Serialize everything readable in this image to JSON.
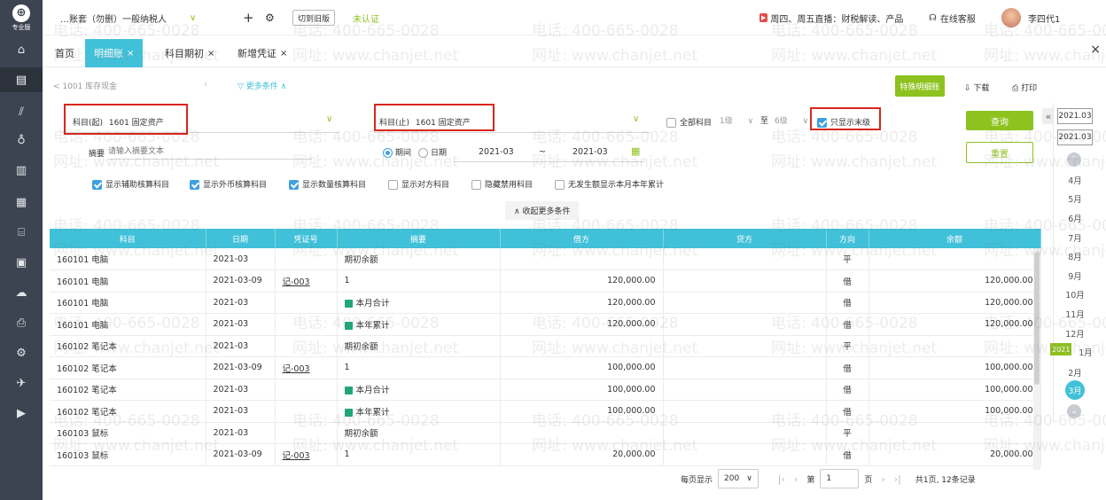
{
  "app": {
    "logo_text": "专业版",
    "account_name": "…账套（勿删）一般纳税人",
    "switch_old_label": "切到旧版",
    "verify_status": "未认证",
    "live_label": "周四、周五直播：财税解读、产品",
    "service_label": "在线客服",
    "user_name": "李四代1"
  },
  "tabs": [
    {
      "label": "首页",
      "active": false,
      "closable": false
    },
    {
      "label": "明细账",
      "active": true,
      "closable": true
    },
    {
      "label": "科目期初",
      "active": false,
      "closable": true
    },
    {
      "label": "新增凭证",
      "active": false,
      "closable": true
    }
  ],
  "toolbar": {
    "breadcrumb": "< 1001 库存现金",
    "more_conditions": "更多条件",
    "special_detail_button": "特殊明细账",
    "download_button": "下载",
    "print_button": "打印"
  },
  "filters": {
    "subject_from_label": "科目(起)",
    "subject_from_value": "1601 固定资产",
    "subject_to_label": "科目(止)",
    "subject_to_value": "1601 固定资产",
    "all_subjects_label": "全部科目",
    "level_from": "1级",
    "level_to_label": "至",
    "level_to": "6级",
    "only_leaf_label": "只显示末级",
    "summary_label": "摘要",
    "summary_placeholder": "请输入摘要文本",
    "period_label": "期间",
    "date_label": "日期",
    "period_from": "2021-03",
    "period_sep": "~",
    "period_to": "2021-03",
    "query_button": "查询",
    "reset_button": "重置",
    "options": [
      {
        "label": "显示辅助核算科目",
        "checked": true
      },
      {
        "label": "显示外币核算科目",
        "checked": true
      },
      {
        "label": "显示数量核算科目",
        "checked": true
      },
      {
        "label": "显示对方科目",
        "checked": false
      },
      {
        "label": "隐藏禁用科目",
        "checked": false
      },
      {
        "label": "无发生额显示本月本年累计",
        "checked": false
      }
    ],
    "collapse_more": "收起更多条件"
  },
  "table": {
    "headers": [
      "科目",
      "日期",
      "凭证号",
      "摘要",
      "借方",
      "贷方",
      "方向",
      "余额"
    ],
    "rows": [
      {
        "subject": "160101 电脑",
        "date": "2021-03",
        "voucher": "",
        "summary": "期初余额",
        "tag": false,
        "debit": "",
        "credit": "",
        "direction": "平",
        "balance": ""
      },
      {
        "subject": "160101 电脑",
        "date": "2021-03-09",
        "voucher": "记-003",
        "summary": "1",
        "tag": false,
        "debit": "120,000.00",
        "credit": "",
        "direction": "借",
        "balance": "120,000.00"
      },
      {
        "subject": "160101 电脑",
        "date": "2021-03",
        "voucher": "",
        "summary": "本月合计",
        "tag": true,
        "debit": "120,000.00",
        "credit": "",
        "direction": "借",
        "balance": "120,000.00"
      },
      {
        "subject": "160101 电脑",
        "date": "2021-03",
        "voucher": "",
        "summary": "本年累计",
        "tag": true,
        "debit": "120,000.00",
        "credit": "",
        "direction": "借",
        "balance": "120,000.00"
      },
      {
        "subject": "160102 笔记本",
        "date": "2021-03",
        "voucher": "",
        "summary": "期初余额",
        "tag": false,
        "debit": "",
        "credit": "",
        "direction": "平",
        "balance": ""
      },
      {
        "subject": "160102 笔记本",
        "date": "2021-03-09",
        "voucher": "记-003",
        "summary": "1",
        "tag": false,
        "debit": "100,000.00",
        "credit": "",
        "direction": "借",
        "balance": "100,000.00"
      },
      {
        "subject": "160102 笔记本",
        "date": "2021-03",
        "voucher": "",
        "summary": "本月合计",
        "tag": true,
        "debit": "100,000.00",
        "credit": "",
        "direction": "借",
        "balance": "100,000.00"
      },
      {
        "subject": "160102 笔记本",
        "date": "2021-03",
        "voucher": "",
        "summary": "本年累计",
        "tag": true,
        "debit": "100,000.00",
        "credit": "",
        "direction": "借",
        "balance": "100,000.00"
      },
      {
        "subject": "160103 鼠标",
        "date": "2021-03",
        "voucher": "",
        "summary": "期初余额",
        "tag": false,
        "debit": "",
        "credit": "",
        "direction": "平",
        "balance": ""
      },
      {
        "subject": "160103 鼠标",
        "date": "2021-03-09",
        "voucher": "记-003",
        "summary": "1",
        "tag": false,
        "debit": "20,000.00",
        "credit": "",
        "direction": "借",
        "balance": "20,000.00"
      }
    ]
  },
  "pagination": {
    "per_page_label": "每页显示",
    "per_page_value": "200",
    "page_prefix": "第",
    "page_value": "1",
    "page_suffix": "页",
    "summary": "共1页, 12条记录"
  },
  "month_rail": {
    "year_top": "2021.03",
    "year_bottom": "2021.03",
    "year_tag": "2021",
    "months": [
      "4月",
      "5月",
      "6月",
      "7月",
      "8月",
      "9月",
      "10月",
      "11月",
      "12月",
      "1月",
      "2月"
    ],
    "active_month": "3月"
  },
  "watermark": {
    "phone": "电话: 400-665-0028",
    "url": "网址: www.chanjet.net"
  },
  "colors": {
    "accent": "#41c1d9",
    "brand_green": "#8dc21f",
    "sidebar_bg": "#3d4451",
    "highlight_red": "#d9261c"
  }
}
